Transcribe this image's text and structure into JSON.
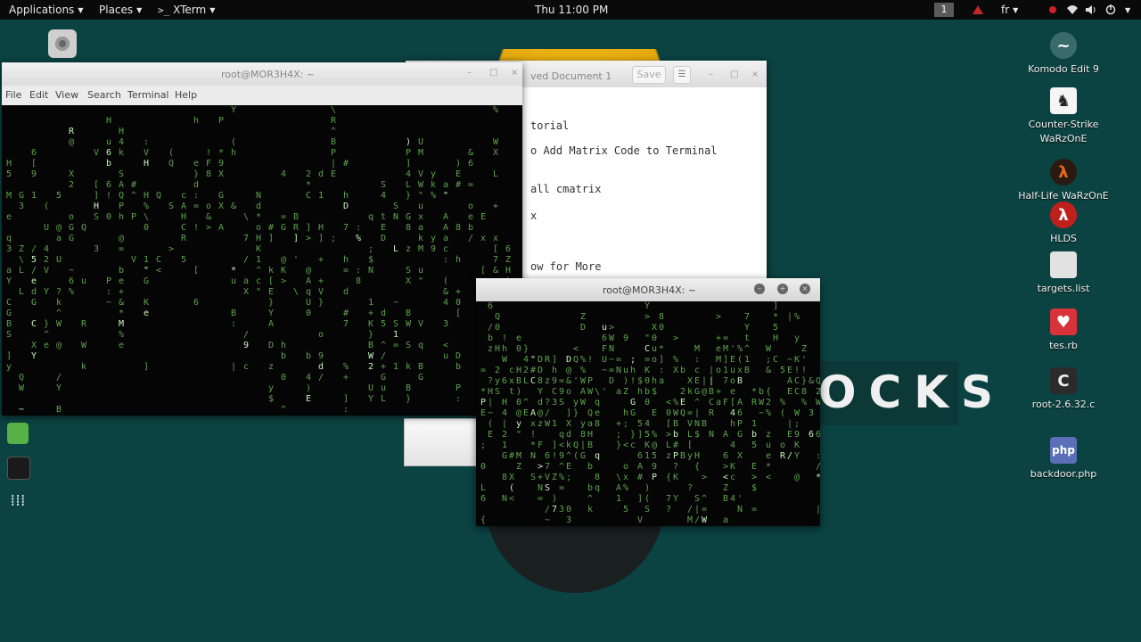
{
  "topbar": {
    "applications": "Applications",
    "places": "Places",
    "active_app": "XTerm",
    "clock": "Thu 11:00 PM",
    "workspace": "1",
    "keyboard_layout": "fr"
  },
  "wallpaper": {
    "text": "OCKS",
    "colors": {
      "background": "#0b4242",
      "sun": "#f4c21a"
    }
  },
  "dock": {
    "icons": [
      "firefox-icon",
      "terminal-icon",
      "files-icon",
      "metasploit-icon",
      "notes-icon",
      "screenshot-icon",
      "camera-icon",
      "music-icon",
      "editor-icon",
      "terminal-2-icon",
      "app-grid-icon"
    ]
  },
  "desktop_icons": [
    {
      "label": "Komodo Edit 9",
      "icon": "komodo-icon"
    },
    {
      "label": "Counter-Strike WaRzOnE",
      "icon": "counter-strike-icon"
    },
    {
      "label": "Half-Life WaRzOnE",
      "icon": "half-life-icon"
    },
    {
      "label": "HLDS",
      "icon": "hlds-icon"
    },
    {
      "label": "targets.list",
      "icon": "text-file-icon"
    },
    {
      "label": "tes.rb",
      "icon": "ruby-file-icon"
    },
    {
      "label": "root-2.6.32.c",
      "icon": "c-file-icon"
    },
    {
      "label": "backdoor.php",
      "icon": "php-file-icon"
    }
  ],
  "terminal_main": {
    "title": "root@MOR3H4X: ~",
    "menu": [
      "File",
      "Edit",
      "View",
      "Search",
      "Terminal",
      "Help"
    ]
  },
  "gedit": {
    "title": "ved Document 1",
    "save": "Save",
    "lines": [
      "torial",
      "o Add Matrix Code to Terminal",
      "all cmatrix",
      "x",
      "ow for More"
    ]
  },
  "xterm": {
    "title": "root@MOR3H4X: ~"
  }
}
